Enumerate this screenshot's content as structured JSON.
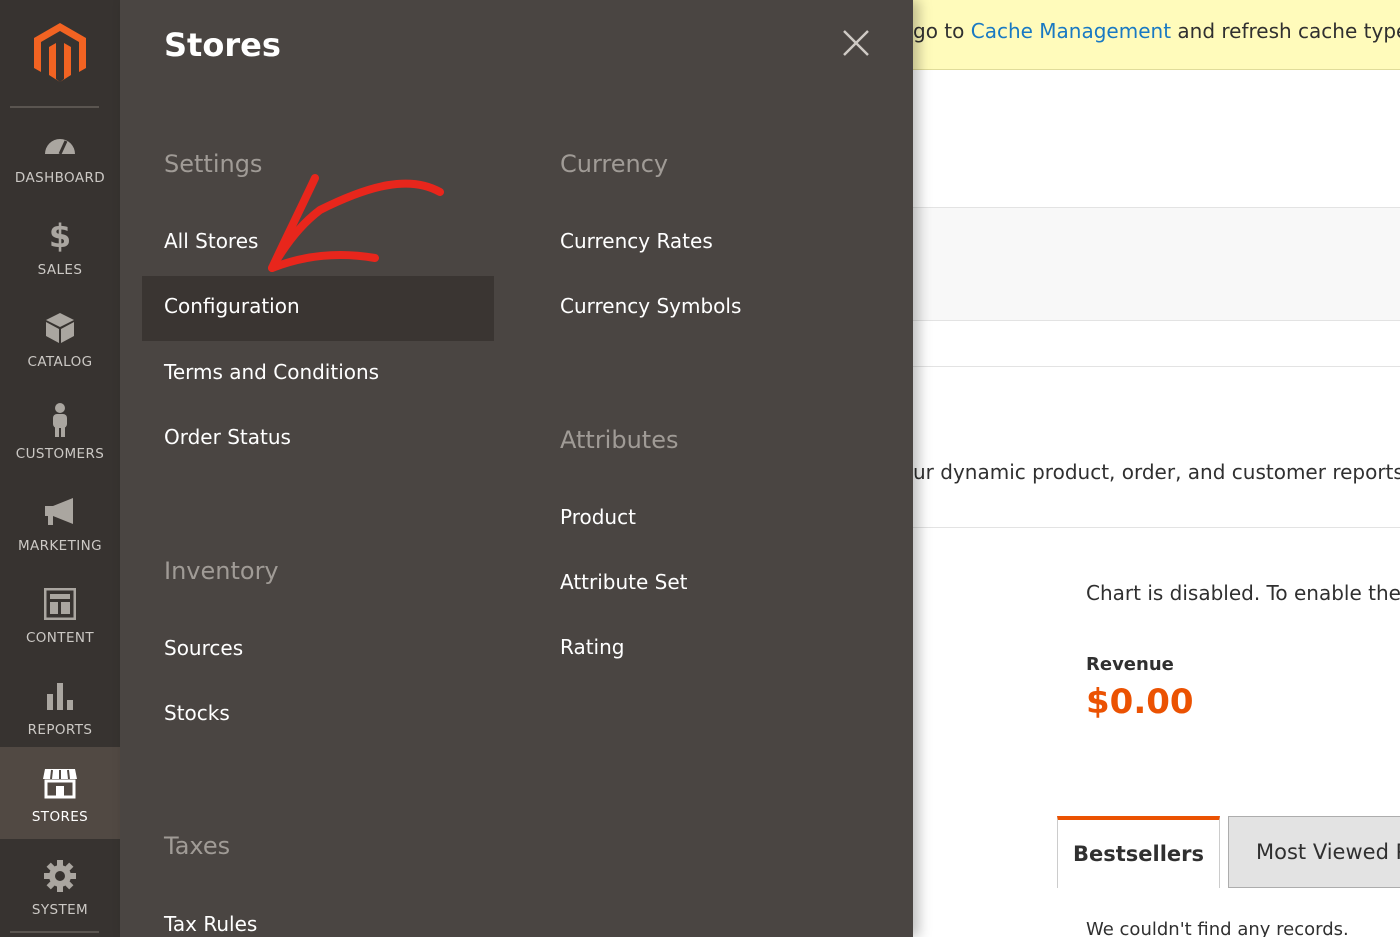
{
  "sidebar": {
    "items": [
      {
        "label": "DASHBOARD",
        "icon": "dashboard-icon"
      },
      {
        "label": "SALES",
        "icon": "dollar-icon"
      },
      {
        "label": "CATALOG",
        "icon": "cube-icon"
      },
      {
        "label": "CUSTOMERS",
        "icon": "person-icon"
      },
      {
        "label": "MARKETING",
        "icon": "megaphone-icon"
      },
      {
        "label": "CONTENT",
        "icon": "layout-icon"
      },
      {
        "label": "REPORTS",
        "icon": "bar-chart-icon"
      },
      {
        "label": "STORES",
        "icon": "storefront-icon"
      },
      {
        "label": "SYSTEM",
        "icon": "gear-icon"
      }
    ],
    "active": "STORES"
  },
  "flyout": {
    "title": "Stores",
    "sections": {
      "settings": {
        "heading": "Settings",
        "links": [
          "All Stores",
          "Configuration",
          "Terms and Conditions",
          "Order Status"
        ]
      },
      "inventory": {
        "heading": "Inventory",
        "links": [
          "Sources",
          "Stocks"
        ]
      },
      "taxes": {
        "heading": "Taxes",
        "links": [
          "Tax Rules"
        ]
      },
      "currency": {
        "heading": "Currency",
        "links": [
          "Currency Rates",
          "Currency Symbols"
        ]
      },
      "attributes": {
        "heading": "Attributes",
        "links": [
          "Product",
          "Attribute Set",
          "Rating"
        ]
      }
    },
    "highlighted": "Configuration"
  },
  "background": {
    "notice": {
      "before": "go to ",
      "link": "Cache Management",
      "after": " and refresh cache types."
    },
    "reports_text": "ur dynamic product, order, and customer reports ta",
    "chart_disabled": "Chart is disabled. To enable the c",
    "revenue_label": "Revenue",
    "revenue_value": "$0.00",
    "tabs": [
      "Bestsellers",
      "Most Viewed P"
    ],
    "no_records": "We couldn't find any records."
  },
  "colors": {
    "accent": "#eb5202",
    "sidebar_bg": "#373330",
    "flyout_bg": "#4a4542",
    "annotation_arrow": "#e8261c"
  }
}
